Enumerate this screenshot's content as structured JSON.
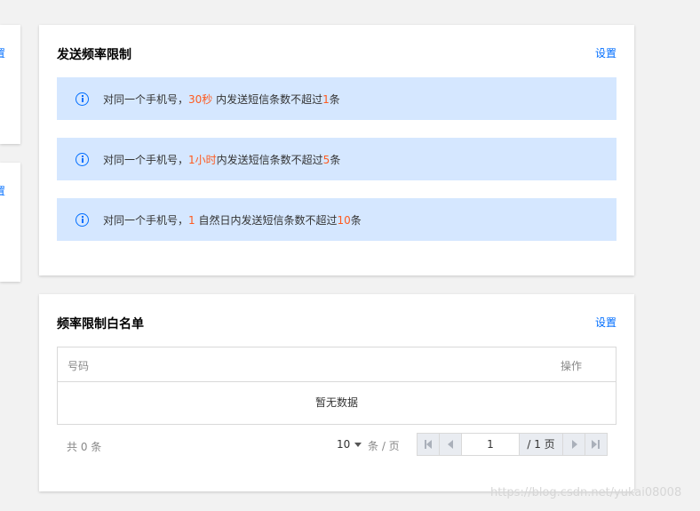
{
  "left_cards": [
    {
      "peek_text": "置"
    },
    {
      "peek_text": "置"
    }
  ],
  "rate_limit": {
    "title": "发送频率限制",
    "action": "设置",
    "notices": [
      {
        "pre": "对同一个手机号，",
        "h1": "30秒",
        "mid": " 内发送短信条数不超过",
        "h2": "1",
        "post": "条"
      },
      {
        "pre": "对同一个手机号，",
        "h1": "1小时",
        "mid": "内发送短信条数不超过",
        "h2": "5",
        "post": "条"
      },
      {
        "pre": "对同一个手机号，",
        "h1": "1",
        "mid": " 自然日内发送短信条数不超过",
        "h2": "10",
        "post": "条"
      }
    ],
    "highlight_color": "#ff5a1f",
    "notice_bg": "#d5e7ff"
  },
  "whitelist": {
    "title": "频率限制白名单",
    "action": "设置",
    "columns": [
      "号码",
      "操作"
    ],
    "empty_text": "暂无数据",
    "pagination": {
      "total_text": "共 0 条",
      "page_size": "10",
      "per_page_label": "条 / 页",
      "current_page": "1",
      "total_pages_text": "/ 1 页"
    }
  },
  "watermark": "https://blog.csdn.net/yukai08008",
  "accent_color": "#006eff"
}
